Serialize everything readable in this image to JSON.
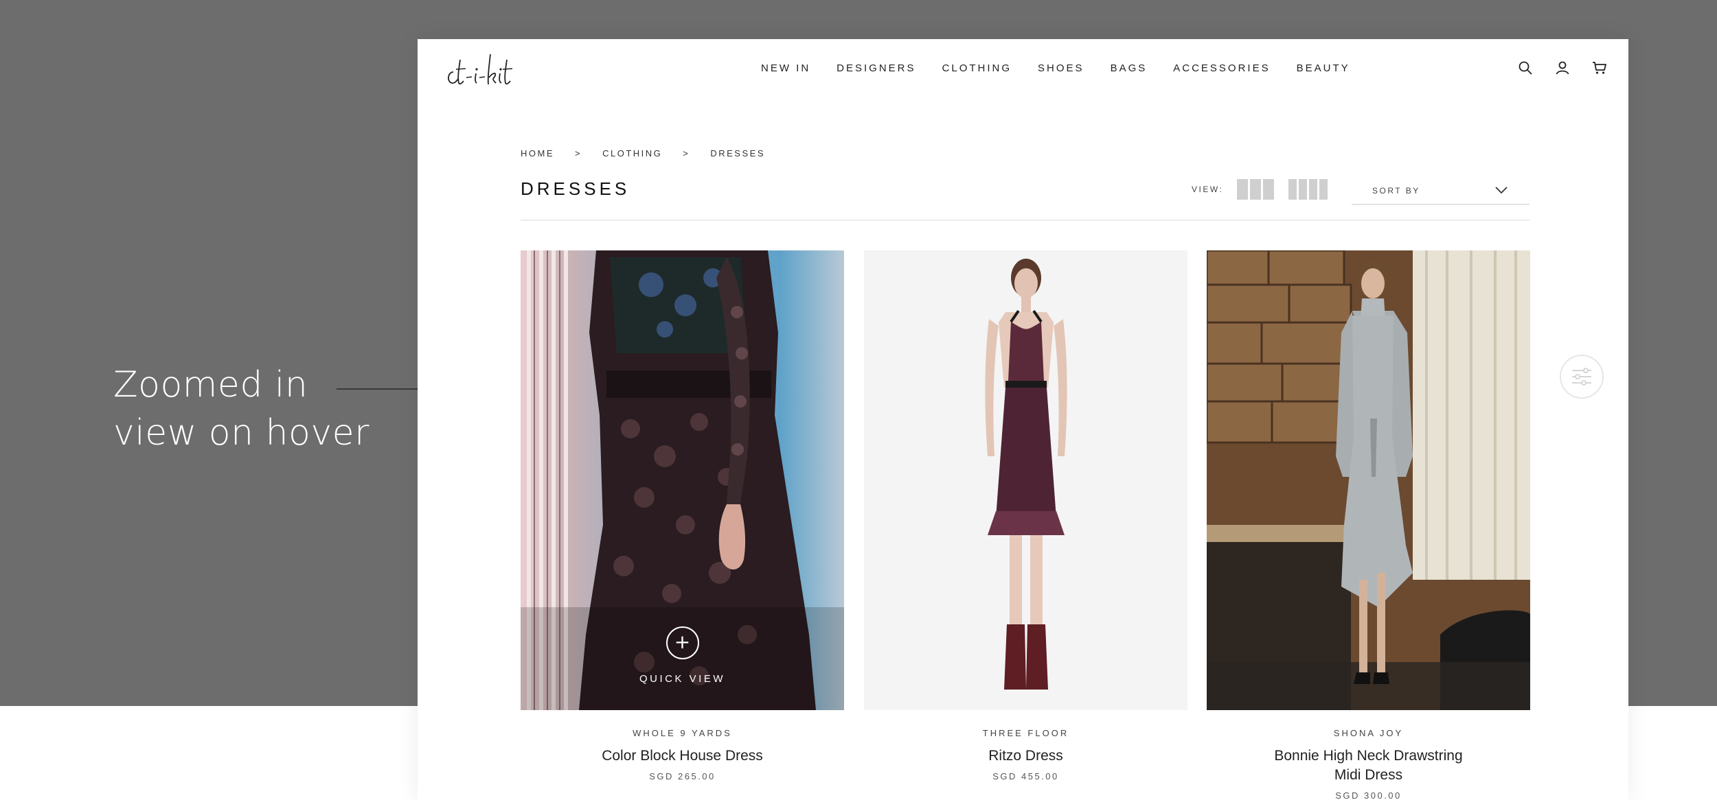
{
  "annotation": {
    "line1": "Zoomed in",
    "line2": "view on hover"
  },
  "header": {
    "logo_text": "ct-i-kit",
    "nav": [
      "NEW IN",
      "DESIGNERS",
      "CLOTHING",
      "SHOES",
      "BAGS",
      "ACCESSORIES",
      "BEAUTY"
    ],
    "icons": [
      "search-icon",
      "account-icon",
      "cart-icon"
    ]
  },
  "breadcrumb": {
    "items": [
      "HOME",
      "CLOTHING",
      "DRESSES"
    ],
    "separator": ">"
  },
  "page_title": "DRESSES",
  "toolbar": {
    "view_label": "VIEW:",
    "view_options": [
      "3-column",
      "4-column"
    ],
    "sort_label": "SORT BY"
  },
  "products": [
    {
      "brand": "WHOLE 9 YARDS",
      "name": "Color Block House Dress",
      "price": "SGD 265.00",
      "quick_view_label": "QUICK VIEW",
      "quick_view_icon": "+"
    },
    {
      "brand": "THREE FLOOR",
      "name": "Ritzo Dress",
      "price": "SGD 455.00"
    },
    {
      "brand": "SHONA JOY",
      "name_line1": "Bonnie High Neck Drawstring",
      "name_line2": "Midi Dress",
      "price": "SGD 300.00"
    }
  ],
  "colors": {
    "backdrop": "#6d6d6d",
    "page": "#ffffff",
    "text": "#222222",
    "view_toggle": "#cfcfcf"
  }
}
